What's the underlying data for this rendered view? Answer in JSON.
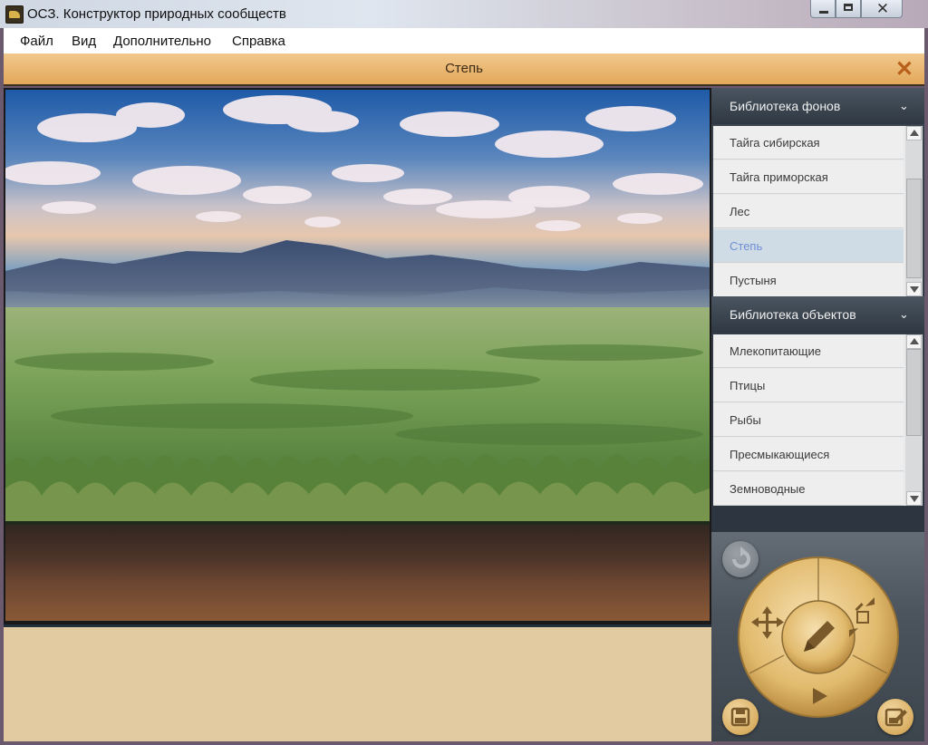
{
  "window": {
    "title": "ОСЗ. Конструктор природных сообществ",
    "close_glyph": "✕"
  },
  "menu": [
    "Файл",
    "Вид",
    "Дополнительно",
    "Справка"
  ],
  "header": {
    "title": "Степь",
    "close_glyph": "✕"
  },
  "sidebar": {
    "backgrounds": {
      "title": "Библиотека фонов",
      "chevron": "⌄",
      "items": [
        {
          "label": "Тайга сибирская",
          "selected": false
        },
        {
          "label": "Тайга приморская",
          "selected": false
        },
        {
          "label": "Лес",
          "selected": false
        },
        {
          "label": "Степь",
          "selected": true
        },
        {
          "label": "Пустыня",
          "selected": false
        }
      ]
    },
    "objects": {
      "title": "Библиотека объектов",
      "chevron": "⌄",
      "items": [
        {
          "label": "Млекопитающие"
        },
        {
          "label": "Птицы"
        },
        {
          "label": "Рыбы"
        },
        {
          "label": "Пресмыкающиеся"
        },
        {
          "label": "Земноводные"
        }
      ]
    }
  },
  "tools": {
    "icons": [
      "undo-icon",
      "move-icon",
      "resize-icon",
      "pencil-icon",
      "play-icon",
      "save-icon",
      "edit-save-icon"
    ],
    "undo_enabled": false
  },
  "colors": {
    "accent_gold": "#e0b86a",
    "header_orange": "#e6ac60",
    "selected_item_text": "#6f8fd6",
    "sidebar_dark": "#2d3640"
  }
}
